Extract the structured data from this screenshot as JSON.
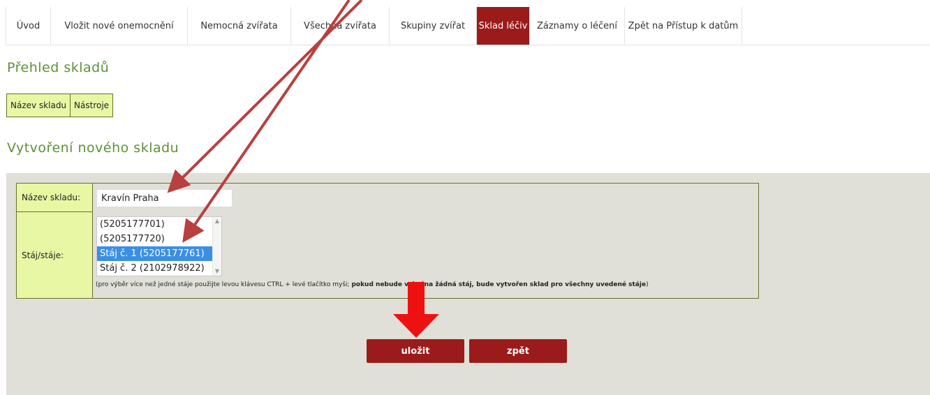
{
  "nav": {
    "tabs": [
      {
        "label": "Úvod",
        "active": false
      },
      {
        "label": "Vložit nové onemocnění",
        "active": false
      },
      {
        "label": "Nemocná zvířata",
        "active": false
      },
      {
        "label": "Všechna zvířata",
        "active": false
      },
      {
        "label": "Skupiny zvířat",
        "active": false
      },
      {
        "label": "Sklad léčiv",
        "active": true
      },
      {
        "label": "Záznamy o léčení",
        "active": false
      },
      {
        "label": "Zpět na Přístup k datům",
        "active": false
      }
    ]
  },
  "overview": {
    "title": "Přehled skladů",
    "columns": [
      "Název skladu",
      "Nástroje"
    ]
  },
  "create": {
    "title": "Vytvoření nového skladu",
    "name_label": "Název skladu:",
    "name_value": "Kravín Praha",
    "stable_label": "Stáj/stáje:",
    "stable_options": [
      {
        "label": "(5205177701)",
        "selected": false
      },
      {
        "label": "(5205177720)",
        "selected": false
      },
      {
        "label": "Stáj č. 1 (5205177761)",
        "selected": true
      },
      {
        "label": "Stáj č. 2 (2102978922)",
        "selected": false
      }
    ],
    "hint_normal": "(pro výběr více než jedné stáje použijte levou klávesu CTRL + levé tlačítko myši; ",
    "hint_bold": "pokud nebude vybrána žádná stáj, bude vytvořen sklad pro všechny uvedené stáje",
    "hint_end": ")",
    "save_label": "uložit",
    "back_label": "zpět"
  },
  "colors": {
    "accent_red": "#9b1b1b",
    "heading_green": "#5f9036",
    "label_bg": "#e8f7a4",
    "arrow_red": "#b8403e",
    "pointer_red": "#ee1111"
  },
  "annotations": {
    "arrows": [
      "arrow-to-name-input",
      "arrow-to-stable-list",
      "arrow-to-save-button"
    ]
  }
}
